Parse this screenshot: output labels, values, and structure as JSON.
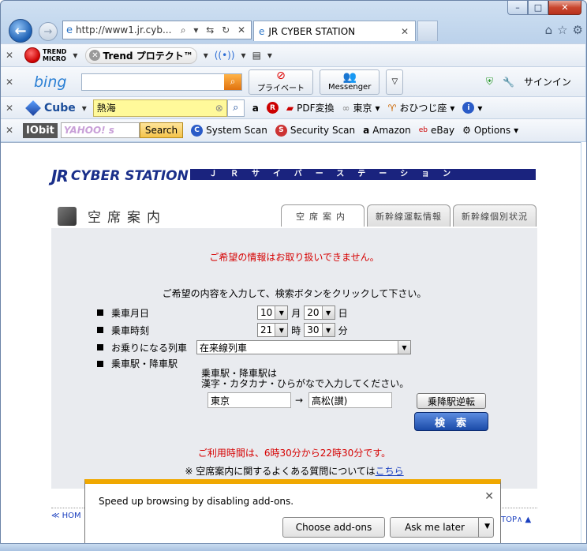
{
  "window": {
    "min": "–",
    "max": "□",
    "close": "✕"
  },
  "nav": {
    "url": "http://www1.jr.cyb...",
    "addr_tools": "⌕ ▾ ⇆ ↻ ✕",
    "tab_title": "JR CYBER STATION",
    "tab_close": "✕"
  },
  "toolbar1": {
    "close": "✕",
    "trend": "TREND\nMICRO",
    "trend_protect": "Trend プロテクト™",
    "caret": "▾"
  },
  "toolbar2": {
    "close": "✕",
    "bing": "bing",
    "privacy": "プライベート",
    "messenger": "Messenger",
    "signin": "サインイン"
  },
  "toolbar3": {
    "close": "✕",
    "cube": "Cube",
    "search_value": "熱海",
    "clear": "⊗",
    "pdf": "PDF変換",
    "tokyo": "東京",
    "horoscope": "おひつじ座"
  },
  "toolbar4": {
    "close": "✕",
    "iobit": "IObit",
    "yahoo": "YAHOO! s",
    "search_btn": "Search",
    "system_scan": "System Scan",
    "security_scan": "Security Scan",
    "amazon": "Amazon",
    "ebay": "eBay",
    "options": "Options"
  },
  "page": {
    "banner": "ＪＲサイバーステーション",
    "logo_jr": "JR",
    "logo_cyber": "CYBER STATION",
    "title": "空席案内",
    "tabs": [
      "空席案内",
      "新幹線運転情報",
      "新幹線個別状況"
    ],
    "error_msg": "ご希望の情報はお取り扱いできません。",
    "instruction": "ご希望の内容を入力して、検索ボタンをクリックして下さい。",
    "labels": {
      "date": "乗車月日",
      "time": "乗車時刻",
      "train": "お乗りになる列車",
      "stations": "乗車駅・降車駅"
    },
    "month": "10",
    "month_unit": "月",
    "day": "20",
    "day_unit": "日",
    "hour": "21",
    "hour_unit": "時",
    "minute": "30",
    "minute_unit": "分",
    "train_type": "在来線列車",
    "station_note_1": "乗車駅・降車駅は",
    "station_note_2": "漢字・カタカナ・ひらがなで入力してください。",
    "from_station": "東京",
    "arrow": "→",
    "to_station": "高松(讃)",
    "reverse_btn": "乗降駅逆転",
    "search_btn": "検索",
    "hours_msg": "ご利用時間は、6時30分から22時30分です。",
    "faq_prefix": "※ 空席案内に関するよくある質問については",
    "faq_link": "こちら",
    "home": "≪ HOM",
    "top": "TOP∧ ▲"
  },
  "notification": {
    "text": "Speed up browsing by disabling add-ons.",
    "choose": "Choose add-ons",
    "ask_later": "Ask me later",
    "close": "✕"
  },
  "colors": {
    "banner": "#1a237e",
    "error": "#d60000",
    "search_btn": "#1a4aa8",
    "notif_accent": "#f0a800"
  }
}
